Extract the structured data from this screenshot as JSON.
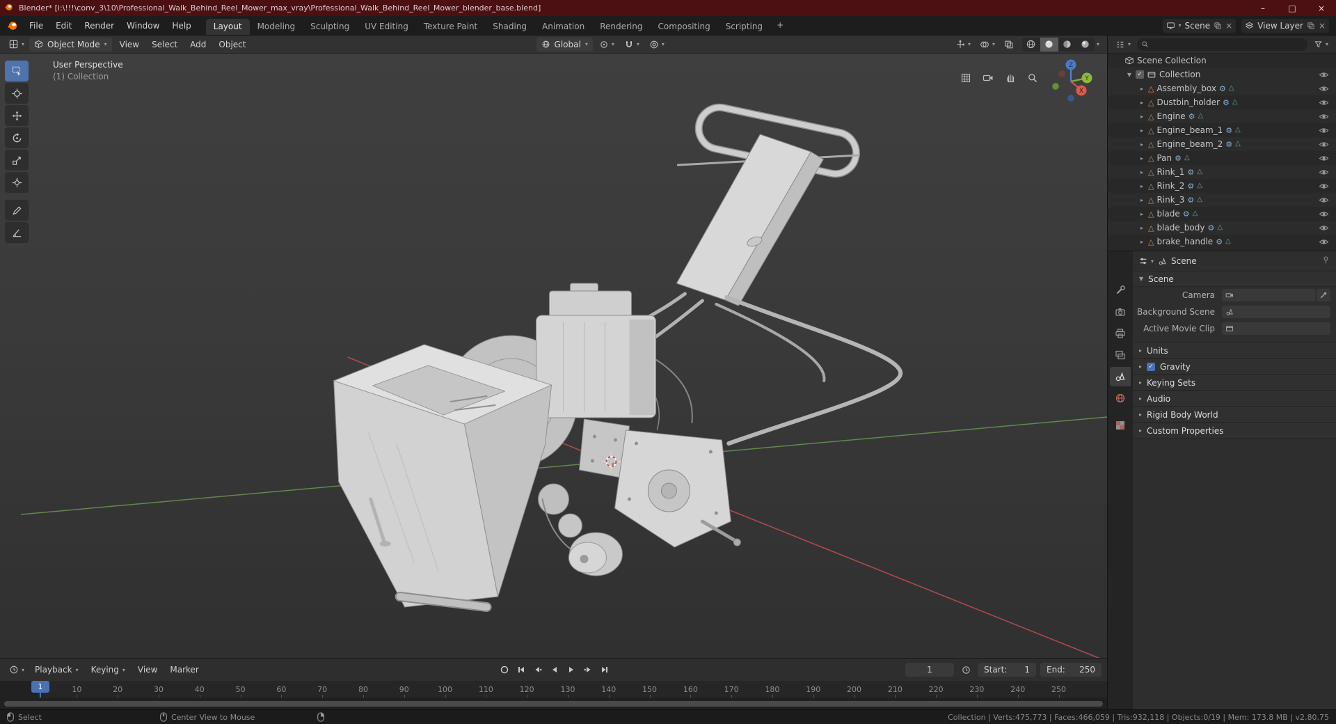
{
  "window": {
    "title": "Blender* [i:\\!!!\\conv_3\\10\\Professional_Walk_Behind_Reel_Mower_max_vray\\Professional_Walk_Behind_Reel_Mower_blender_base.blend]",
    "minimize": "–",
    "maximize": "□",
    "close": "×"
  },
  "topbar": {
    "menus": [
      "File",
      "Edit",
      "Render",
      "Window",
      "Help"
    ],
    "tabs": [
      "Layout",
      "Modeling",
      "Sculpting",
      "UV Editing",
      "Texture Paint",
      "Shading",
      "Animation",
      "Rendering",
      "Compositing",
      "Scripting"
    ],
    "active_tab": "Layout",
    "new_workspace_label": "+",
    "scene_selector": {
      "label": "Scene",
      "unlink": "×"
    },
    "view_layer_selector": {
      "label": "View Layer",
      "unlink": "×"
    }
  },
  "viewport": {
    "header": {
      "mode": "Object Mode",
      "menus": [
        "View",
        "Select",
        "Add",
        "Object"
      ],
      "orientation": "Global",
      "shading_modes": [
        "wireframe",
        "solid",
        "material-preview",
        "rendered"
      ],
      "active_shading": "solid"
    },
    "overlay": {
      "line1": "User Perspective",
      "line2": "(1) Collection"
    },
    "gizmo": {
      "axes": [
        "X",
        "Y",
        "Z"
      ]
    },
    "nav_icons": [
      "grid-icon",
      "camera-icon",
      "pan-hand-icon",
      "zoom-icon"
    ]
  },
  "toolbar": {
    "active_tool": "select-box",
    "tools": [
      "select-box",
      "cursor",
      "move",
      "rotate",
      "scale",
      "transform",
      "annotate",
      "measure"
    ]
  },
  "outliner": {
    "root": "Scene Collection",
    "collection": {
      "label": "Collection",
      "checked": "✓"
    },
    "items": [
      "Assembly_box",
      "Dustbin_holder",
      "Engine",
      "Engine_beam_1",
      "Engine_beam_2",
      "Pan",
      "Rink_1",
      "Rink_2",
      "Rink_3",
      "blade",
      "blade_body",
      "brake_handle"
    ]
  },
  "properties": {
    "tabs": [
      "tool",
      "render",
      "output",
      "view-layer",
      "scene",
      "world",
      "texture"
    ],
    "active_tab_name": "scene",
    "breadcrumb": "Scene",
    "scene_panel_title": "Scene",
    "scene_fields": [
      {
        "label": "Camera"
      },
      {
        "label": "Background Scene"
      },
      {
        "label": "Active Movie Clip"
      }
    ],
    "sections_top": [
      "Units"
    ],
    "gravity": {
      "label": "Gravity",
      "checked": "✓"
    },
    "sections_bottom": [
      "Keying Sets",
      "Audio",
      "Rigid Body World",
      "Custom Properties"
    ]
  },
  "timeline": {
    "menus": [
      "Playback",
      "Keying",
      "View",
      "Marker"
    ],
    "transport": [
      "auto-key",
      "jump-to-start",
      "jump-to-prev-keyframe",
      "play-reverse",
      "play",
      "jump-to-next-keyframe",
      "jump-to-end"
    ],
    "current_frame": "1",
    "start": {
      "label": "Start:",
      "value": "1"
    },
    "end": {
      "label": "End:",
      "value": "250"
    },
    "playhead": "1",
    "ticks": [
      10,
      20,
      30,
      40,
      50,
      60,
      70,
      80,
      90,
      100,
      110,
      120,
      130,
      140,
      150,
      160,
      170,
      180,
      190,
      200,
      210,
      220,
      230,
      240,
      250
    ]
  },
  "statusbar": {
    "items": [
      {
        "icon": "mouse-left-icon",
        "label": "Select"
      },
      {
        "icon": "mouse-middle-icon",
        "label": "Center View to Mouse"
      },
      {
        "icon": "mouse-right-icon",
        "label": ""
      }
    ],
    "stats": "Collection | Verts:475,773 | Faces:466,059 | Tris:932,118 | Objects:0/19 | Mem: 173.8 MB | v2.80.75"
  },
  "colors": {
    "accent": "#4772b3",
    "titlebar": "#4c0f12",
    "axis_x": "#c44e4e",
    "axis_y": "#6d9e52",
    "active_tool": "#4f74ad",
    "mesh_icon": "#dd8a3d",
    "mesh_data_icon": "#56b673",
    "modifier_icon": "#86aed2"
  }
}
